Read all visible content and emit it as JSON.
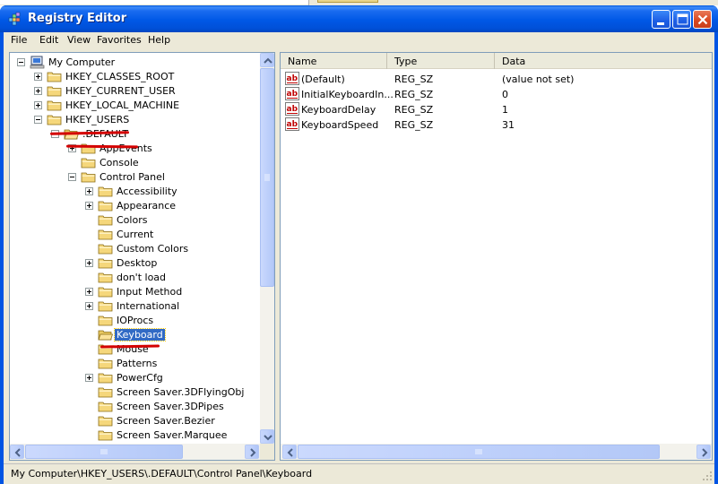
{
  "window": {
    "title": "Registry Editor"
  },
  "menu": [
    "File",
    "Edit",
    "View",
    "Favorites",
    "Help"
  ],
  "tree": [
    {
      "label": "My Computer",
      "level": 0,
      "expander": "minus",
      "icon": "computer-icon"
    },
    {
      "label": "HKEY_CLASSES_ROOT",
      "level": 1,
      "expander": "plus",
      "icon": "folder-icon"
    },
    {
      "label": "HKEY_CURRENT_USER",
      "level": 1,
      "expander": "plus",
      "icon": "folder-icon"
    },
    {
      "label": "HKEY_LOCAL_MACHINE",
      "level": 1,
      "expander": "plus",
      "icon": "folder-icon"
    },
    {
      "label": "HKEY_USERS",
      "level": 1,
      "expander": "minus",
      "icon": "folder-icon"
    },
    {
      "label": ".DEFAULT",
      "level": 2,
      "expander": "minus",
      "icon": "open-folder-icon"
    },
    {
      "label": "AppEvents",
      "level": 3,
      "expander": "plus",
      "icon": "folder-icon"
    },
    {
      "label": "Console",
      "level": 3,
      "expander": "none",
      "icon": "folder-icon"
    },
    {
      "label": "Control Panel",
      "level": 3,
      "expander": "minus",
      "icon": "folder-icon"
    },
    {
      "label": "Accessibility",
      "level": 4,
      "expander": "plus",
      "icon": "folder-icon"
    },
    {
      "label": "Appearance",
      "level": 4,
      "expander": "plus",
      "icon": "folder-icon"
    },
    {
      "label": "Colors",
      "level": 4,
      "expander": "none",
      "icon": "folder-icon"
    },
    {
      "label": "Current",
      "level": 4,
      "expander": "none",
      "icon": "folder-icon"
    },
    {
      "label": "Custom Colors",
      "level": 4,
      "expander": "none",
      "icon": "folder-icon"
    },
    {
      "label": "Desktop",
      "level": 4,
      "expander": "plus",
      "icon": "folder-icon"
    },
    {
      "label": "don't load",
      "level": 4,
      "expander": "none",
      "icon": "folder-icon"
    },
    {
      "label": "Input Method",
      "level": 4,
      "expander": "plus",
      "icon": "folder-icon"
    },
    {
      "label": "International",
      "level": 4,
      "expander": "plus",
      "icon": "folder-icon"
    },
    {
      "label": "IOProcs",
      "level": 4,
      "expander": "none",
      "icon": "folder-icon"
    },
    {
      "label": "Keyboard",
      "level": 4,
      "expander": "none",
      "icon": "open-folder-icon",
      "selected": true
    },
    {
      "label": "Mouse",
      "level": 4,
      "expander": "none",
      "icon": "folder-icon"
    },
    {
      "label": "Patterns",
      "level": 4,
      "expander": "none",
      "icon": "folder-icon"
    },
    {
      "label": "PowerCfg",
      "level": 4,
      "expander": "plus",
      "icon": "folder-icon"
    },
    {
      "label": "Screen Saver.3DFlyingObj",
      "level": 4,
      "expander": "none",
      "icon": "folder-icon"
    },
    {
      "label": "Screen Saver.3DPipes",
      "level": 4,
      "expander": "none",
      "icon": "folder-icon"
    },
    {
      "label": "Screen Saver.Bezier",
      "level": 4,
      "expander": "none",
      "icon": "folder-icon"
    },
    {
      "label": "Screen Saver.Marquee",
      "level": 4,
      "expander": "none",
      "icon": "folder-icon"
    }
  ],
  "list": {
    "columns": [
      "Name",
      "Type",
      "Data"
    ],
    "rows": [
      {
        "icon": "string-value-icon",
        "name": "(Default)",
        "type": "REG_SZ",
        "data": "(value not set)"
      },
      {
        "icon": "string-value-icon",
        "name": "InitialKeyboardIn...",
        "type": "REG_SZ",
        "data": "0"
      },
      {
        "icon": "string-value-icon",
        "name": "KeyboardDelay",
        "type": "REG_SZ",
        "data": "1"
      },
      {
        "icon": "string-value-icon",
        "name": "KeyboardSpeed",
        "type": "REG_SZ",
        "data": "31"
      }
    ]
  },
  "status": {
    "path": "My Computer\\HKEY_USERS\\.DEFAULT\\Control Panel\\Keyboard"
  },
  "colors": {
    "titlebar": "#0054e3",
    "selection": "#316ac5",
    "annotation": "#d40000",
    "face": "#ece9d8"
  }
}
